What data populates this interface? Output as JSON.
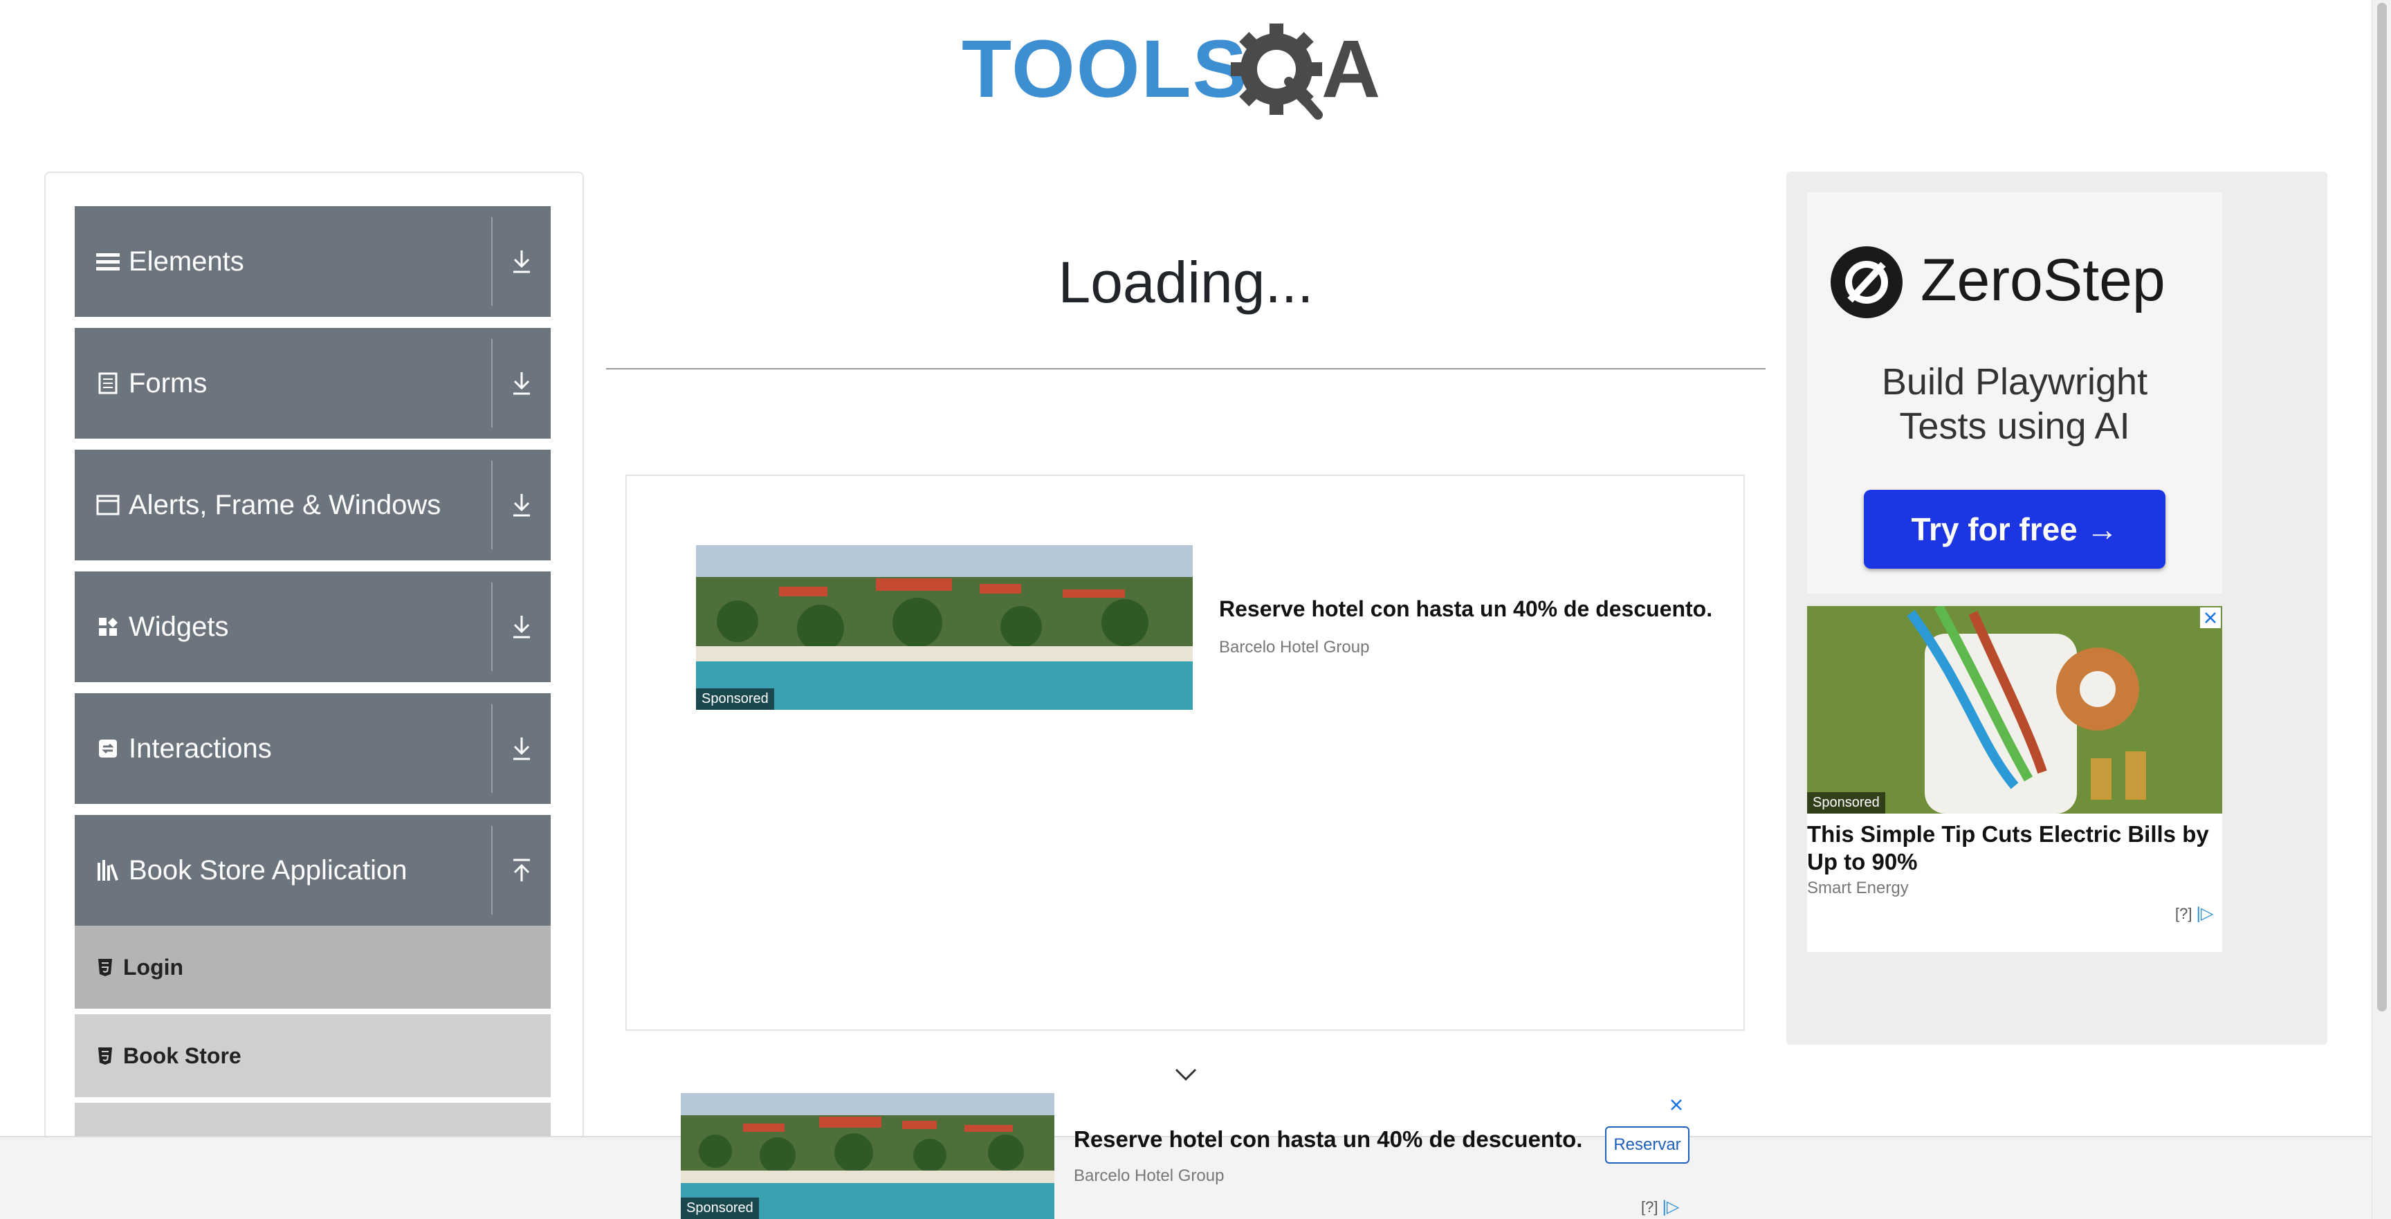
{
  "header": {
    "logo_text": "TOOLSQA",
    "logo_tools": "TOOLS",
    "logo_qa": "A"
  },
  "sidebar": {
    "groups": [
      {
        "label": "Elements",
        "icon": "list-icon",
        "state": "collapsed"
      },
      {
        "label": "Forms",
        "icon": "document-icon",
        "state": "collapsed"
      },
      {
        "label": "Alerts, Frame & Windows",
        "icon": "window-icon",
        "state": "collapsed"
      },
      {
        "label": "Widgets",
        "icon": "widgets-icon",
        "state": "collapsed"
      },
      {
        "label": "Interactions",
        "icon": "interactions-icon",
        "state": "collapsed"
      },
      {
        "label": "Book Store Application",
        "icon": "books-icon",
        "state": "expanded"
      }
    ],
    "book_store_items": [
      {
        "label": "Login",
        "active": true
      },
      {
        "label": "Book Store",
        "active": false
      }
    ]
  },
  "main": {
    "loading_text": "Loading..."
  },
  "ad_inline": {
    "title": "Reserve hotel con hasta un 40% de descuento.",
    "advertiser": "Barcelo Hotel Group",
    "sponsored": "Sponsored"
  },
  "ad_right": {
    "brand": "ZeroStep",
    "tagline_line1": "Build Playwright",
    "tagline_line2": "Tests using AI",
    "cta": "Try for free →",
    "second_ad_title": "This Simple Tip Cuts Electric Bills by Up to 90%",
    "second_ad_advertiser": "Smart Energy",
    "sponsored": "Sponsored",
    "info": "[?]"
  },
  "ad_bottom": {
    "title": "Reserve hotel con hasta un 40% de descuento.",
    "advertiser": "Barcelo Hotel Group",
    "cta": "Reservar",
    "sponsored": "Sponsored",
    "info": "[?]"
  },
  "colors": {
    "sidebar_header": "#6c757d",
    "sub_item": "#cfcfcf",
    "sub_item_active": "#b4b4b4",
    "logo_blue": "#3d8fd1",
    "logo_gray": "#4a4a4a",
    "cta_blue": "#1c36e3"
  }
}
